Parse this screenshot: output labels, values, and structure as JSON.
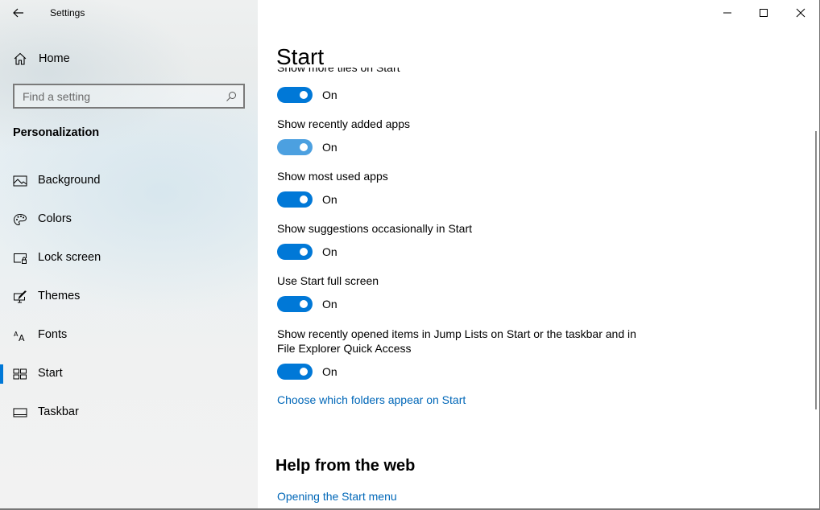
{
  "window": {
    "title": "Settings",
    "controls": {
      "minimize": "minimize",
      "maximize": "maximize",
      "close": "close"
    }
  },
  "sidebar": {
    "home_label": "Home",
    "search_placeholder": "Find a setting",
    "section_title": "Personalization",
    "items": [
      {
        "label": "Background",
        "icon": "image-icon",
        "selected": false
      },
      {
        "label": "Colors",
        "icon": "palette-icon",
        "selected": false
      },
      {
        "label": "Lock screen",
        "icon": "lock-screen-icon",
        "selected": false
      },
      {
        "label": "Themes",
        "icon": "themes-icon",
        "selected": false
      },
      {
        "label": "Fonts",
        "icon": "fonts-icon",
        "selected": false
      },
      {
        "label": "Start",
        "icon": "start-icon",
        "selected": true
      },
      {
        "label": "Taskbar",
        "icon": "taskbar-icon",
        "selected": false
      }
    ]
  },
  "main": {
    "title": "Start",
    "settings": [
      {
        "label": "Show more tiles on Start",
        "state": "On",
        "on": true
      },
      {
        "label": "Show recently added apps",
        "state": "On",
        "on": true
      },
      {
        "label": "Show most used apps",
        "state": "On",
        "on": true
      },
      {
        "label": "Show suggestions occasionally in Start",
        "state": "On",
        "on": true
      },
      {
        "label": "Use Start full screen",
        "state": "On",
        "on": true
      },
      {
        "label_line1": "Show recently opened items in Jump Lists on Start or the taskbar and in",
        "label_line2": "File Explorer Quick Access",
        "state": "On",
        "on": true
      }
    ],
    "folders_link": "Choose which folders appear on Start",
    "help_heading": "Help from the web",
    "help_link": "Opening the Start menu"
  },
  "colors": {
    "accent": "#0078d7",
    "toggle_hover": "#4ca0e0",
    "link": "#0067b8"
  }
}
